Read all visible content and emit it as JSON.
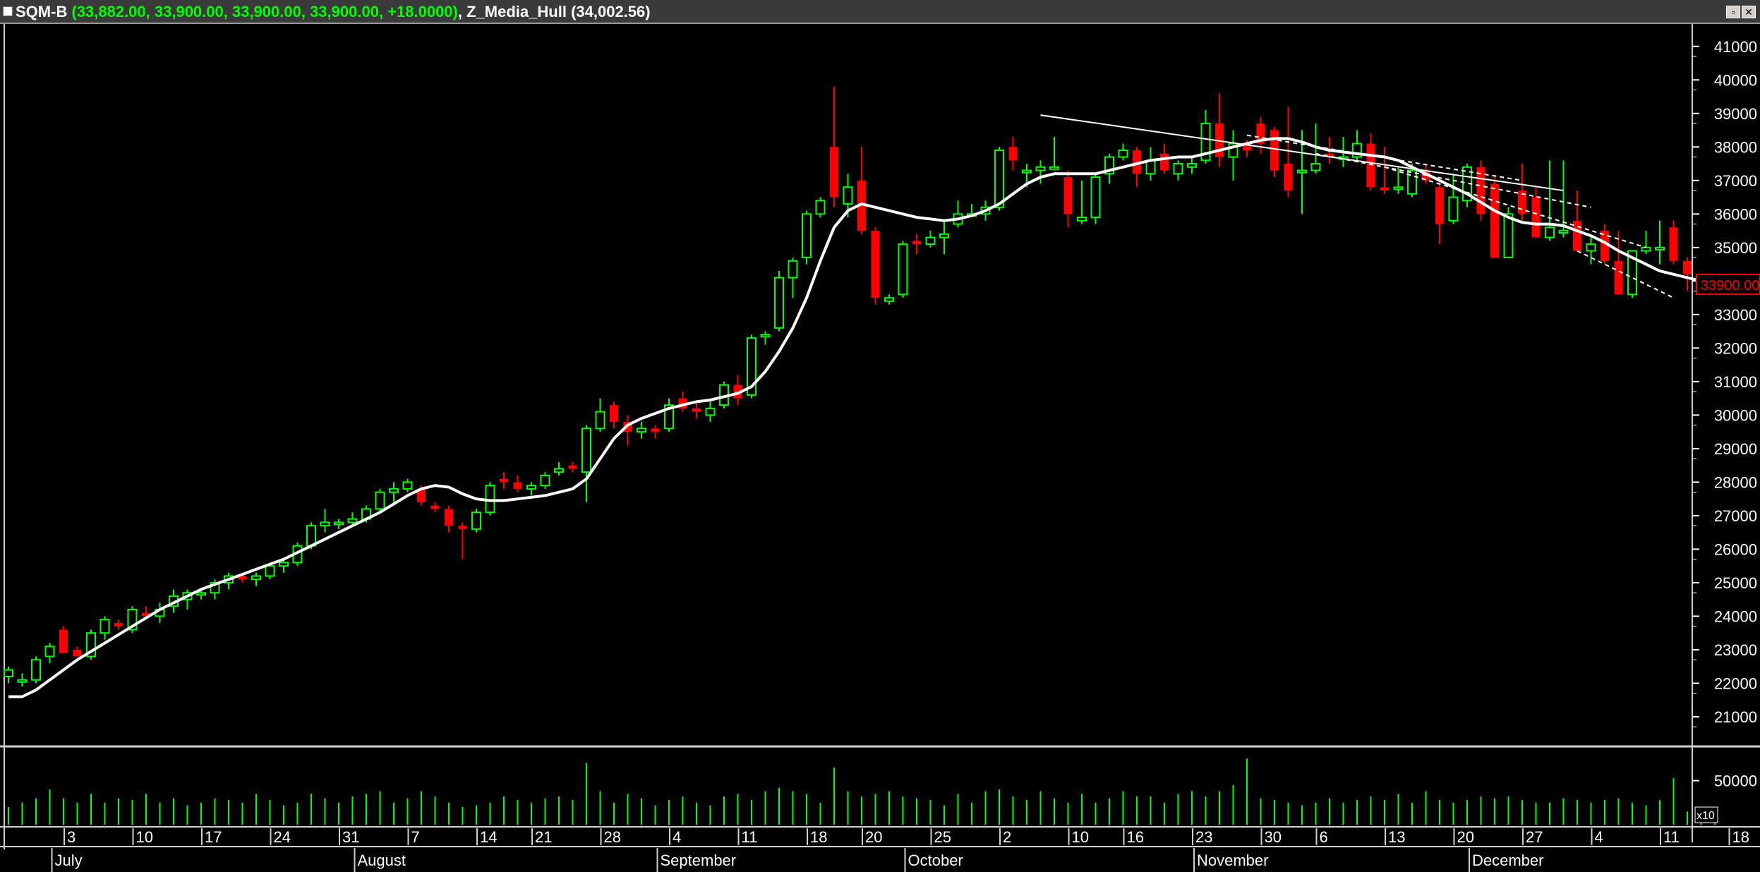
{
  "window": {
    "symbol": "SQM-B",
    "quote": "(33,882.00, 33,900.00, 33,900.00, 33,900.00, +18.0000)",
    "indicator_sep": ",",
    "indicator_name": "Z_Media_Hull",
    "indicator_value": "(34,002.56)",
    "restore_glyph": "▫",
    "close_glyph": "✕"
  },
  "colors": {
    "up": "#00ff00",
    "down": "#ff0000",
    "ma": "#ffffff",
    "trend": "#ffffff",
    "background": "#000000",
    "price_marker": "#ff0000"
  },
  "chart_data": {
    "type": "candlestick",
    "symbol": "SQM-B",
    "ylim": [
      20200,
      41500
    ],
    "y_ticks": [
      21000,
      22000,
      23000,
      24000,
      25000,
      26000,
      27000,
      28000,
      29000,
      30000,
      31000,
      32000,
      33000,
      34000,
      35000,
      36000,
      37000,
      38000,
      39000,
      40000,
      41000
    ],
    "last_price_label": "33900.00",
    "series": [
      {
        "name": "SQM-B",
        "candles": [
          [
            22200,
            22500,
            22000,
            22400
          ],
          [
            22100,
            22300,
            21900,
            22100
          ],
          [
            22100,
            22800,
            22000,
            22700
          ],
          [
            22800,
            23200,
            22600,
            23100
          ],
          [
            23600,
            23700,
            22900,
            22900
          ],
          [
            23000,
            23100,
            22800,
            22800
          ],
          [
            22800,
            23600,
            22700,
            23500
          ],
          [
            23500,
            24000,
            23300,
            23900
          ],
          [
            23800,
            23900,
            23600,
            23700
          ],
          [
            23600,
            24300,
            23500,
            24200
          ],
          [
            24100,
            24300,
            23900,
            24000
          ],
          [
            24000,
            24400,
            23800,
            24200
          ],
          [
            24300,
            24800,
            24100,
            24600
          ],
          [
            24500,
            24800,
            24200,
            24700
          ],
          [
            24700,
            24800,
            24500,
            24700
          ],
          [
            24700,
            25100,
            24500,
            25000
          ],
          [
            25000,
            25300,
            24800,
            25200
          ],
          [
            25200,
            25300,
            25000,
            25100
          ],
          [
            25100,
            25300,
            24900,
            25200
          ],
          [
            25200,
            25600,
            25100,
            25500
          ],
          [
            25500,
            25700,
            25300,
            25600
          ],
          [
            25600,
            26200,
            25500,
            26100
          ],
          [
            26100,
            26800,
            26000,
            26700
          ],
          [
            26700,
            27200,
            26500,
            26800
          ],
          [
            26800,
            26900,
            26600,
            26800
          ],
          [
            26800,
            27100,
            26700,
            26900
          ],
          [
            26900,
            27300,
            26800,
            27200
          ],
          [
            27200,
            27800,
            27100,
            27700
          ],
          [
            27700,
            28000,
            27400,
            27800
          ],
          [
            27800,
            28100,
            27700,
            28000
          ],
          [
            27800,
            27900,
            27300,
            27400
          ],
          [
            27300,
            27400,
            27100,
            27200
          ],
          [
            27200,
            27300,
            26500,
            26700
          ],
          [
            26700,
            26800,
            25700,
            26600
          ],
          [
            26600,
            27200,
            26500,
            27100
          ],
          [
            27100,
            28000,
            27000,
            27900
          ],
          [
            28100,
            28300,
            27800,
            28000
          ],
          [
            28000,
            28200,
            27700,
            27800
          ],
          [
            27800,
            28000,
            27600,
            27900
          ],
          [
            27900,
            28300,
            27800,
            28200
          ],
          [
            28300,
            28600,
            28200,
            28400
          ],
          [
            28500,
            28600,
            28300,
            28400
          ],
          [
            28300,
            29700,
            27400,
            29600
          ],
          [
            29600,
            30500,
            29500,
            30100
          ],
          [
            30300,
            30400,
            29600,
            29800
          ],
          [
            29800,
            30000,
            29100,
            29500
          ],
          [
            29500,
            29800,
            29300,
            29600
          ],
          [
            29600,
            29700,
            29300,
            29500
          ],
          [
            29600,
            30500,
            29500,
            30300
          ],
          [
            30500,
            30700,
            30100,
            30200
          ],
          [
            30200,
            30400,
            29900,
            30100
          ],
          [
            30000,
            30400,
            29800,
            30200
          ],
          [
            30300,
            31000,
            30200,
            30900
          ],
          [
            30900,
            31200,
            30300,
            30500
          ],
          [
            30600,
            32400,
            30500,
            32300
          ],
          [
            32400,
            32500,
            32100,
            32400
          ],
          [
            32600,
            34300,
            32500,
            34100
          ],
          [
            34100,
            34700,
            33500,
            34600
          ],
          [
            34700,
            36100,
            34500,
            36000
          ],
          [
            36000,
            36500,
            35900,
            36400
          ],
          [
            38000,
            39800,
            36200,
            36500
          ],
          [
            36300,
            37200,
            35900,
            36800
          ],
          [
            37000,
            38000,
            35400,
            35500
          ],
          [
            35500,
            35600,
            33300,
            33500
          ],
          [
            33400,
            33600,
            33300,
            33500
          ],
          [
            33600,
            35200,
            33500,
            35100
          ],
          [
            35200,
            35400,
            34800,
            35100
          ],
          [
            35100,
            35500,
            35000,
            35300
          ],
          [
            35300,
            35800,
            34800,
            35400
          ],
          [
            35700,
            36400,
            35600,
            36000
          ],
          [
            36000,
            36300,
            35900,
            36000
          ],
          [
            36000,
            36400,
            35800,
            36200
          ],
          [
            36200,
            38000,
            36100,
            37900
          ],
          [
            38000,
            38300,
            37300,
            37600
          ],
          [
            37300,
            37500,
            36800,
            37300
          ],
          [
            37300,
            37600,
            36900,
            37400
          ],
          [
            37400,
            38300,
            37400,
            37400
          ],
          [
            37100,
            37300,
            35600,
            36000
          ],
          [
            35800,
            37000,
            35700,
            35900
          ],
          [
            35900,
            37200,
            35700,
            37100
          ],
          [
            37200,
            37800,
            36900,
            37700
          ],
          [
            37700,
            38100,
            37600,
            37900
          ],
          [
            37900,
            38000,
            36800,
            37200
          ],
          [
            37200,
            38000,
            37000,
            37600
          ],
          [
            37800,
            38100,
            37200,
            37300
          ],
          [
            37200,
            37600,
            37000,
            37500
          ],
          [
            37400,
            37700,
            37200,
            37500
          ],
          [
            37600,
            39100,
            37500,
            38700
          ],
          [
            38700,
            39600,
            37400,
            37700
          ],
          [
            37700,
            38500,
            37000,
            38100
          ],
          [
            38100,
            38200,
            37700,
            37900
          ],
          [
            38700,
            38900,
            37800,
            38100
          ],
          [
            38500,
            38600,
            37100,
            37300
          ],
          [
            37500,
            39200,
            36500,
            36700
          ],
          [
            37300,
            38500,
            36000,
            37300
          ],
          [
            37300,
            38700,
            37200,
            37500
          ],
          [
            37800,
            38300,
            37500,
            37700
          ],
          [
            37700,
            38300,
            37400,
            37700
          ],
          [
            37700,
            38500,
            37600,
            38100
          ],
          [
            38100,
            38400,
            36700,
            36800
          ],
          [
            36800,
            38000,
            36600,
            36700
          ],
          [
            36800,
            37400,
            36600,
            36800
          ],
          [
            36600,
            37500,
            36500,
            37300
          ],
          [
            37300,
            37500,
            36900,
            37000
          ],
          [
            36800,
            37000,
            35100,
            35700
          ],
          [
            35800,
            37200,
            35700,
            36500
          ],
          [
            36400,
            37500,
            36200,
            37400
          ],
          [
            37400,
            37600,
            35800,
            36000
          ],
          [
            36900,
            37100,
            34700,
            34700
          ],
          [
            34700,
            36200,
            34700,
            36000
          ],
          [
            36700,
            37500,
            35800,
            36000
          ],
          [
            36500,
            36800,
            35300,
            35300
          ],
          [
            35300,
            37600,
            35200,
            35600
          ],
          [
            35500,
            37600,
            35300,
            35500
          ],
          [
            35800,
            36700,
            34900,
            34900
          ],
          [
            34900,
            35300,
            34500,
            35100
          ],
          [
            35500,
            35700,
            34500,
            34600
          ],
          [
            34600,
            35500,
            33600,
            33600
          ],
          [
            33600,
            34900,
            33500,
            34900
          ],
          [
            34900,
            35500,
            34800,
            35000
          ],
          [
            35000,
            35800,
            34500,
            35000
          ],
          [
            35600,
            35800,
            34500,
            34600
          ],
          [
            34600,
            34700,
            33700,
            34200
          ],
          [
            33900,
            34000,
            33800,
            33900
          ]
        ]
      },
      {
        "name": "Z_Media_Hull",
        "values": [
          21600,
          21600,
          21800,
          22100,
          22400,
          22700,
          22950,
          23200,
          23450,
          23700,
          23950,
          24200,
          24400,
          24600,
          24800,
          24950,
          25100,
          25250,
          25400,
          25550,
          25700,
          25900,
          26100,
          26300,
          26500,
          26700,
          26900,
          27100,
          27350,
          27600,
          27800,
          27900,
          27850,
          27650,
          27500,
          27450,
          27450,
          27500,
          27550,
          27600,
          27700,
          27800,
          28100,
          28700,
          29300,
          29700,
          29900,
          30050,
          30200,
          30300,
          30400,
          30450,
          30550,
          30650,
          30850,
          31300,
          31900,
          32600,
          33500,
          34600,
          35600,
          36100,
          36300,
          36200,
          36100,
          36000,
          35900,
          35850,
          35800,
          35850,
          35950,
          36100,
          36300,
          36600,
          36900,
          37100,
          37200,
          37200,
          37200,
          37200,
          37300,
          37400,
          37500,
          37600,
          37650,
          37700,
          37700,
          37800,
          37900,
          38000,
          38100,
          38200,
          38250,
          38250,
          38150,
          38000,
          37900,
          37850,
          37800,
          37750,
          37700,
          37600,
          37400,
          37200,
          37000,
          36800,
          36600,
          36350,
          36100,
          35900,
          35750,
          35700,
          35700,
          35650,
          35500,
          35350,
          35150,
          34900,
          34700,
          34500,
          34300,
          34200,
          34100,
          34002.56
        ]
      }
    ],
    "volume": [
      20,
      25,
      30,
      40,
      30,
      25,
      35,
      25,
      30,
      28,
      35,
      25,
      30,
      22,
      25,
      30,
      28,
      25,
      35,
      28,
      22,
      25,
      35,
      30,
      25,
      32,
      35,
      38,
      25,
      30,
      38,
      32,
      25,
      20,
      22,
      25,
      32,
      28,
      25,
      30,
      32,
      28,
      70,
      38,
      25,
      35,
      30,
      22,
      28,
      32,
      25,
      22,
      32,
      35,
      28,
      38,
      42,
      38,
      35,
      25,
      65,
      38,
      32,
      35,
      38,
      32,
      30,
      28,
      22,
      35,
      25,
      38,
      40,
      32,
      28,
      38,
      30,
      25,
      35,
      25,
      30,
      38,
      32,
      32,
      25,
      35,
      38,
      32,
      38,
      45,
      75,
      30,
      28,
      25,
      22,
      25,
      30,
      25,
      28,
      32,
      28,
      35,
      25,
      38,
      28,
      25,
      28,
      32,
      30,
      32,
      28,
      25,
      25,
      30,
      28,
      25,
      28,
      30,
      25,
      22,
      28,
      53,
      15,
      20,
      15
    ],
    "volume_ticks": [
      "50000"
    ],
    "volume_scale": "x10",
    "trendlines": [
      {
        "from": [
          75,
          38950
        ],
        "to": [
          113,
          36700
        ]
      },
      {
        "from": [
          90,
          38350
        ],
        "to": [
          110,
          37000
        ],
        "style": "dashed"
      },
      {
        "from": [
          95,
          37800
        ],
        "to": [
          115,
          36200
        ],
        "style": "dashed"
      },
      {
        "from": [
          100,
          37400
        ],
        "to": [
          119,
          35000
        ],
        "style": "dashed"
      },
      {
        "from": [
          114,
          34900
        ],
        "to": [
          121,
          33500
        ],
        "style": "dashed"
      }
    ],
    "x_day_labels": [
      {
        "i": 2,
        "label": "3"
      },
      {
        "i": 7,
        "label": "10"
      },
      {
        "i": 12,
        "label": "17"
      },
      {
        "i": 17,
        "label": "24"
      },
      {
        "i": 22,
        "label": "31"
      },
      {
        "i": 27,
        "label": "7"
      },
      {
        "i": 32,
        "label": "14"
      },
      {
        "i": 36,
        "label": "21"
      },
      {
        "i": 41,
        "label": "28"
      },
      {
        "i": 46,
        "label": "4"
      },
      {
        "i": 51,
        "label": "11"
      },
      {
        "i": 56,
        "label": "18"
      },
      {
        "i": 60,
        "label": "20"
      },
      {
        "i": 65,
        "label": "25"
      },
      {
        "i": 70,
        "label": "2"
      },
      {
        "i": 75,
        "label": "10"
      },
      {
        "i": 79,
        "label": "16"
      },
      {
        "i": 84,
        "label": "23"
      },
      {
        "i": 89,
        "label": "30"
      },
      {
        "i": 93,
        "label": "6"
      },
      {
        "i": 98,
        "label": "13"
      },
      {
        "i": 103,
        "label": "20"
      },
      {
        "i": 108,
        "label": "27"
      },
      {
        "i": 113,
        "label": "4"
      },
      {
        "i": 118,
        "label": "11"
      },
      {
        "i": 123,
        "label": "18"
      }
    ],
    "x_month_labels": [
      {
        "i": 1,
        "label": "July"
      },
      {
        "i": 23,
        "label": "August"
      },
      {
        "i": 45,
        "label": "September"
      },
      {
        "i": 63,
        "label": "October"
      },
      {
        "i": 84,
        "label": "November"
      },
      {
        "i": 104,
        "label": "December"
      }
    ]
  }
}
